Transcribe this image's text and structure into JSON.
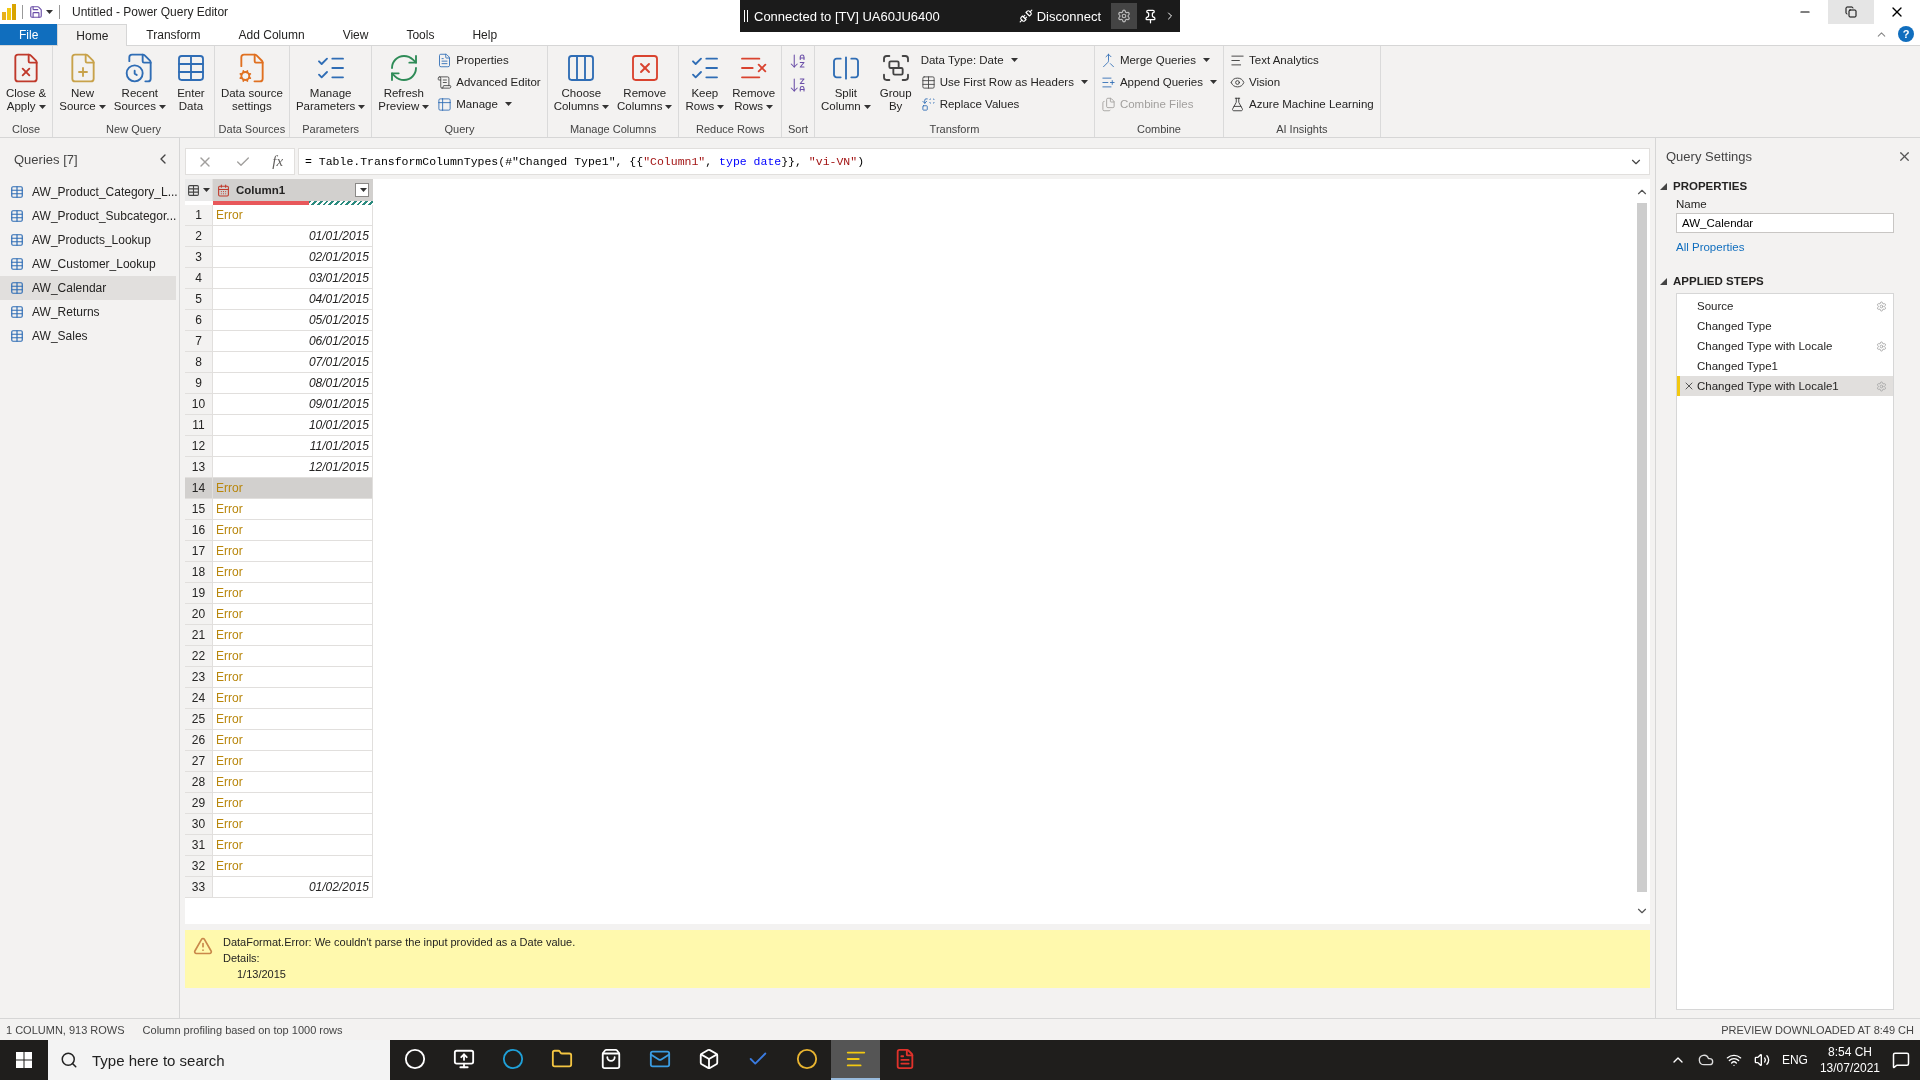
{
  "title_bar": {
    "title": "Untitled - Power Query Editor",
    "connection": "Connected to [TV] UA60JU6400",
    "disconnect": "Disconnect",
    "help_glyph": "?"
  },
  "ribbon_tabs": [
    {
      "label": "File",
      "kind": "file",
      "selected": false
    },
    {
      "label": "Home",
      "kind": "tab",
      "selected": true
    },
    {
      "label": "Transform",
      "kind": "tab",
      "selected": false
    },
    {
      "label": "Add Column",
      "kind": "tab",
      "selected": false
    },
    {
      "label": "View",
      "kind": "tab",
      "selected": false
    },
    {
      "label": "Tools",
      "kind": "tab",
      "selected": false
    },
    {
      "label": "Help",
      "kind": "tab",
      "selected": false
    }
  ],
  "ribbon_groups": [
    {
      "label": "Close",
      "items": [
        {
          "kind": "large",
          "label": "Close &\nApply",
          "dropdown": true
        }
      ]
    },
    {
      "label": "New Query",
      "items": [
        {
          "kind": "large",
          "label": "New\nSource",
          "dropdown": true
        },
        {
          "kind": "large",
          "label": "Recent\nSources",
          "dropdown": true
        },
        {
          "kind": "large",
          "label": "Enter\nData",
          "dropdown": false
        }
      ]
    },
    {
      "label": "Data Sources",
      "items": [
        {
          "kind": "large",
          "label": "Data source\nsettings",
          "dropdown": false
        }
      ]
    },
    {
      "label": "Parameters",
      "items": [
        {
          "kind": "large",
          "label": "Manage\nParameters",
          "dropdown": true
        }
      ]
    },
    {
      "label": "Query",
      "items": [
        {
          "kind": "large",
          "label": "Refresh\nPreview",
          "dropdown": true
        },
        {
          "kind": "stack",
          "items": [
            {
              "kind": "small",
              "label": "Properties",
              "dropdown": false,
              "disabled": false
            },
            {
              "kind": "small",
              "label": "Advanced Editor",
              "dropdown": false,
              "disabled": false
            },
            {
              "kind": "small",
              "label": "Manage",
              "dropdown": true,
              "disabled": false
            }
          ]
        }
      ]
    },
    {
      "label": "Manage Columns",
      "items": [
        {
          "kind": "large",
          "label": "Choose\nColumns",
          "dropdown": true
        },
        {
          "kind": "large",
          "label": "Remove\nColumns",
          "dropdown": true
        }
      ]
    },
    {
      "label": "Reduce Rows",
      "items": [
        {
          "kind": "large",
          "label": "Keep\nRows",
          "dropdown": true
        },
        {
          "kind": "large",
          "label": "Remove\nRows",
          "dropdown": true
        }
      ]
    },
    {
      "label": "Sort",
      "items": [
        {
          "kind": "sort"
        }
      ]
    },
    {
      "label": "Transform",
      "items": [
        {
          "kind": "large",
          "label": "Split\nColumn",
          "dropdown": true
        },
        {
          "kind": "large",
          "label": "Group\nBy",
          "dropdown": false
        },
        {
          "kind": "stack",
          "items": [
            {
              "kind": "small-text",
              "label": "Data Type: Date",
              "dropdown": true,
              "disabled": false
            },
            {
              "kind": "small",
              "label": "Use First Row as Headers",
              "dropdown": true,
              "disabled": false
            },
            {
              "kind": "small",
              "label": "Replace Values",
              "dropdown": false,
              "disabled": false
            }
          ]
        }
      ]
    },
    {
      "label": "Combine",
      "items": [
        {
          "kind": "stack",
          "items": [
            {
              "kind": "small",
              "label": "Merge Queries",
              "dropdown": true,
              "disabled": false
            },
            {
              "kind": "small",
              "label": "Append Queries",
              "dropdown": true,
              "disabled": false
            },
            {
              "kind": "small",
              "label": "Combine Files",
              "dropdown": false,
              "disabled": true
            }
          ]
        }
      ]
    },
    {
      "label": "AI Insights",
      "items": [
        {
          "kind": "stack",
          "items": [
            {
              "kind": "small",
              "label": "Text Analytics",
              "dropdown": false,
              "disabled": false
            },
            {
              "kind": "small",
              "label": "Vision",
              "dropdown": false,
              "disabled": false
            },
            {
              "kind": "small",
              "label": "Azure Machine Learning",
              "dropdown": false,
              "disabled": false
            }
          ]
        }
      ]
    }
  ],
  "queries": {
    "title": "Queries [7]",
    "items": [
      {
        "name": "AW_Product_Category_L...",
        "selected": false
      },
      {
        "name": "AW_Product_Subcategor...",
        "selected": false
      },
      {
        "name": "AW_Products_Lookup",
        "selected": false
      },
      {
        "name": "AW_Customer_Lookup",
        "selected": false
      },
      {
        "name": "AW_Calendar",
        "selected": true
      },
      {
        "name": "AW_Returns",
        "selected": false
      },
      {
        "name": "AW_Sales",
        "selected": false
      }
    ]
  },
  "formula": {
    "fx_label": "fx",
    "tokens": [
      {
        "text": "= Table.TransformColumnTypes(#\"Changed Type1\", {{",
        "kind": "plain"
      },
      {
        "text": "\"Column1\"",
        "kind": "string"
      },
      {
        "text": ", ",
        "kind": "plain"
      },
      {
        "text": "type date",
        "kind": "keyword"
      },
      {
        "text": "}}, ",
        "kind": "plain"
      },
      {
        "text": "\"vi-VN\"",
        "kind": "string"
      },
      {
        "text": ")",
        "kind": "plain"
      }
    ]
  },
  "table": {
    "column": "Column1",
    "quality": {
      "level": 0.6
    },
    "rows": [
      {
        "number": "1",
        "value": "Error",
        "kind": "error",
        "selected": false
      },
      {
        "number": "2",
        "value": "01/01/2015",
        "kind": "date",
        "selected": false
      },
      {
        "number": "3",
        "value": "02/01/2015",
        "kind": "date",
        "selected": false
      },
      {
        "number": "4",
        "value": "03/01/2015",
        "kind": "date",
        "selected": false
      },
      {
        "number": "5",
        "value": "04/01/2015",
        "kind": "date",
        "selected": false
      },
      {
        "number": "6",
        "value": "05/01/2015",
        "kind": "date",
        "selected": false
      },
      {
        "number": "7",
        "value": "06/01/2015",
        "kind": "date",
        "selected": false
      },
      {
        "number": "8",
        "value": "07/01/2015",
        "kind": "date",
        "selected": false
      },
      {
        "number": "9",
        "value": "08/01/2015",
        "kind": "date",
        "selected": false
      },
      {
        "number": "10",
        "value": "09/01/2015",
        "kind": "date",
        "selected": false
      },
      {
        "number": "11",
        "value": "10/01/2015",
        "kind": "date",
        "selected": false
      },
      {
        "number": "12",
        "value": "11/01/2015",
        "kind": "date",
        "selected": false
      },
      {
        "number": "13",
        "value": "12/01/2015",
        "kind": "date",
        "selected": false
      },
      {
        "number": "14",
        "value": "Error",
        "kind": "error",
        "selected": true
      },
      {
        "number": "15",
        "value": "Error",
        "kind": "error",
        "selected": false
      },
      {
        "number": "16",
        "value": "Error",
        "kind": "error",
        "selected": false
      },
      {
        "number": "17",
        "value": "Error",
        "kind": "error",
        "selected": false
      },
      {
        "number": "18",
        "value": "Error",
        "kind": "error",
        "selected": false
      },
      {
        "number": "19",
        "value": "Error",
        "kind": "error",
        "selected": false
      },
      {
        "number": "20",
        "value": "Error",
        "kind": "error",
        "selected": false
      },
      {
        "number": "21",
        "value": "Error",
        "kind": "error",
        "selected": false
      },
      {
        "number": "22",
        "value": "Error",
        "kind": "error",
        "selected": false
      },
      {
        "number": "23",
        "value": "Error",
        "kind": "error",
        "selected": false
      },
      {
        "number": "24",
        "value": "Error",
        "kind": "error",
        "selected": false
      },
      {
        "number": "25",
        "value": "Error",
        "kind": "error",
        "selected": false
      },
      {
        "number": "26",
        "value": "Error",
        "kind": "error",
        "selected": false
      },
      {
        "number": "27",
        "value": "Error",
        "kind": "error",
        "selected": false
      },
      {
        "number": "28",
        "value": "Error",
        "kind": "error",
        "selected": false
      },
      {
        "number": "29",
        "value": "Error",
        "kind": "error",
        "selected": false
      },
      {
        "number": "30",
        "value": "Error",
        "kind": "error",
        "selected": false
      },
      {
        "number": "31",
        "value": "Error",
        "kind": "error",
        "selected": false
      },
      {
        "number": "32",
        "value": "Error",
        "kind": "error",
        "selected": false
      },
      {
        "number": "33",
        "value": "01/02/2015",
        "kind": "date",
        "selected": false
      }
    ]
  },
  "error_detail": {
    "message": "DataFormat.Error: We couldn't parse the input provided as a Date value.",
    "details_label": "Details:",
    "details_value": "1/13/2015"
  },
  "query_settings": {
    "title": "Query Settings",
    "properties_heading": "PROPERTIES",
    "name_label": "Name",
    "name_value": "AW_Calendar",
    "all_properties": "All Properties",
    "steps_heading": "APPLIED STEPS",
    "steps": [
      {
        "name": "Source",
        "settings": true,
        "selected": false
      },
      {
        "name": "Changed Type",
        "settings": false,
        "selected": false
      },
      {
        "name": "Changed Type with Locale",
        "settings": true,
        "selected": false
      },
      {
        "name": "Changed Type1",
        "settings": false,
        "selected": false
      },
      {
        "name": "Changed Type with Locale1",
        "settings": true,
        "selected": true
      }
    ]
  },
  "status_bar": {
    "left": [
      "1 COLUMN, 913 ROWS",
      "Column profiling based on top 1000 rows"
    ],
    "right": "PREVIEW DOWNLOADED AT 8:49 CH"
  },
  "taskbar": {
    "search_placeholder": "Type here to search",
    "apps": [
      {
        "kind": "cortana",
        "active": false
      },
      {
        "kind": "taskview",
        "active": false
      },
      {
        "kind": "edge",
        "active": false
      },
      {
        "kind": "explorer",
        "active": false
      },
      {
        "kind": "store",
        "active": false
      },
      {
        "kind": "mail",
        "active": false
      },
      {
        "kind": "cube",
        "active": false
      },
      {
        "kind": "todo",
        "active": false
      },
      {
        "kind": "chrome",
        "active": false
      },
      {
        "kind": "powerbi",
        "active": true
      },
      {
        "kind": "acrobat",
        "active": false
      }
    ],
    "language": "ENG",
    "time": "8:54 CH",
    "date": "13/07/2021"
  }
}
